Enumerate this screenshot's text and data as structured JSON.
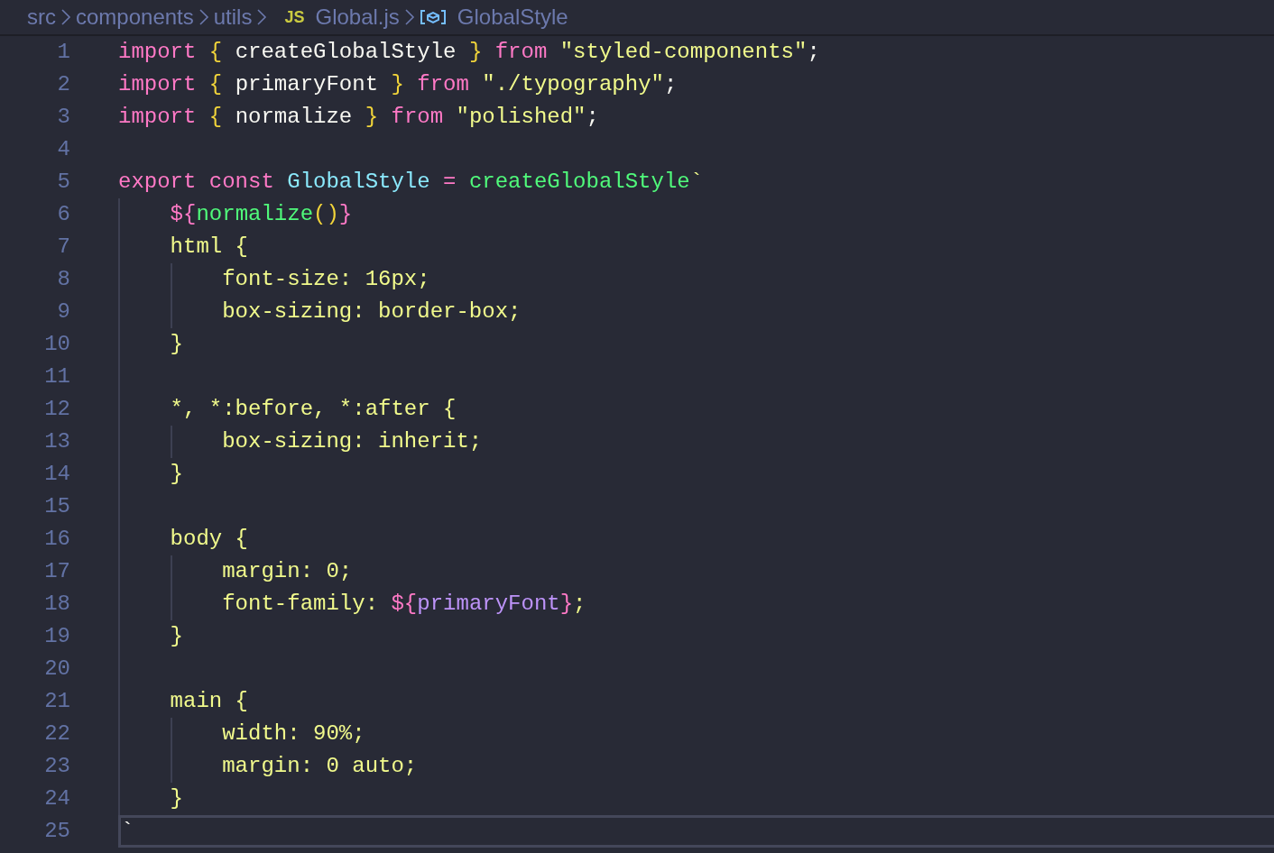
{
  "breadcrumb": [
    {
      "kind": "folder",
      "label": "src"
    },
    {
      "kind": "folder",
      "label": "components"
    },
    {
      "kind": "folder",
      "label": "utils"
    },
    {
      "kind": "file",
      "badge": "JS",
      "label": "Global.js"
    },
    {
      "kind": "symbol",
      "label": "GlobalStyle"
    }
  ],
  "lines": [
    {
      "number": "1",
      "current": false,
      "tokens": [
        {
          "kind": "keyword",
          "text": "import "
        },
        {
          "kind": "brace",
          "text": "{"
        },
        {
          "kind": "plain",
          "text": " createGlobalStyle "
        },
        {
          "kind": "brace",
          "text": "} "
        },
        {
          "kind": "keyword",
          "text": "from "
        },
        {
          "kind": "string",
          "text": "\"styled-components\""
        },
        {
          "kind": "plain",
          "text": ";"
        }
      ]
    },
    {
      "number": "2",
      "current": false,
      "tokens": [
        {
          "kind": "keyword",
          "text": "import "
        },
        {
          "kind": "brace",
          "text": "{"
        },
        {
          "kind": "plain",
          "text": " primaryFont "
        },
        {
          "kind": "brace",
          "text": "} "
        },
        {
          "kind": "keyword",
          "text": "from "
        },
        {
          "kind": "string",
          "text": "\"./typography\""
        },
        {
          "kind": "plain",
          "text": ";"
        }
      ]
    },
    {
      "number": "3",
      "current": false,
      "tokens": [
        {
          "kind": "keyword",
          "text": "import "
        },
        {
          "kind": "brace",
          "text": "{"
        },
        {
          "kind": "plain",
          "text": " normalize "
        },
        {
          "kind": "brace",
          "text": "} "
        },
        {
          "kind": "keyword",
          "text": "from "
        },
        {
          "kind": "string",
          "text": "\"polished\""
        },
        {
          "kind": "plain",
          "text": ";"
        }
      ]
    },
    {
      "number": "4",
      "current": false
    },
    {
      "number": "5",
      "current": false,
      "tokens": [
        {
          "kind": "keyword",
          "text": "export const "
        },
        {
          "kind": "class",
          "text": "GlobalStyle "
        },
        {
          "kind": "keyword",
          "text": "= "
        },
        {
          "kind": "function",
          "text": "createGlobalStyle"
        },
        {
          "kind": "string",
          "text": "`"
        }
      ]
    },
    {
      "number": "6",
      "current": false,
      "tokens": [
        {
          "kind": "interp",
          "text": "    ${"
        },
        {
          "kind": "function",
          "text": "normalize"
        },
        {
          "kind": "brace",
          "text": "()"
        },
        {
          "kind": "interp",
          "text": "}"
        }
      ]
    },
    {
      "number": "7",
      "current": false,
      "tokens": [
        {
          "kind": "string",
          "text": "    html {"
        }
      ]
    },
    {
      "number": "8",
      "current": false,
      "tokens": [
        {
          "kind": "string",
          "text": "        font-size: 16px;"
        }
      ]
    },
    {
      "number": "9",
      "current": false,
      "tokens": [
        {
          "kind": "string",
          "text": "        box-sizing: border-box;"
        }
      ]
    },
    {
      "number": "10",
      "current": false,
      "tokens": [
        {
          "kind": "string",
          "text": "    }"
        }
      ]
    },
    {
      "number": "11",
      "current": false
    },
    {
      "number": "12",
      "current": false,
      "tokens": [
        {
          "kind": "string",
          "text": "    *, *:before, *:after {"
        }
      ]
    },
    {
      "number": "13",
      "current": false,
      "tokens": [
        {
          "kind": "string",
          "text": "        box-sizing: inherit;"
        }
      ]
    },
    {
      "number": "14",
      "current": false,
      "tokens": [
        {
          "kind": "string",
          "text": "    }"
        }
      ]
    },
    {
      "number": "15",
      "current": false
    },
    {
      "number": "16",
      "current": false,
      "tokens": [
        {
          "kind": "string",
          "text": "    body {"
        }
      ]
    },
    {
      "number": "17",
      "current": false,
      "tokens": [
        {
          "kind": "string",
          "text": "        margin: 0;"
        }
      ]
    },
    {
      "number": "18",
      "current": false,
      "tokens": [
        {
          "kind": "string",
          "text": "        font-family: "
        },
        {
          "kind": "interp",
          "text": "${"
        },
        {
          "kind": "variable",
          "text": "primaryFont"
        },
        {
          "kind": "interp",
          "text": "}"
        },
        {
          "kind": "string",
          "text": ";"
        }
      ]
    },
    {
      "number": "19",
      "current": false,
      "tokens": [
        {
          "kind": "string",
          "text": "    }"
        }
      ]
    },
    {
      "number": "20",
      "current": false
    },
    {
      "number": "21",
      "current": false,
      "tokens": [
        {
          "kind": "string",
          "text": "    main {"
        }
      ]
    },
    {
      "number": "22",
      "current": false,
      "tokens": [
        {
          "kind": "string",
          "text": "        width: 90%;"
        }
      ]
    },
    {
      "number": "23",
      "current": false,
      "tokens": [
        {
          "kind": "string",
          "text": "        margin: 0 auto;"
        }
      ]
    },
    {
      "number": "24",
      "current": false,
      "tokens": [
        {
          "kind": "string",
          "text": "    }"
        }
      ]
    },
    {
      "number": "25",
      "current": true,
      "tokens": [
        {
          "kind": "plain",
          "text": "`"
        }
      ]
    }
  ]
}
